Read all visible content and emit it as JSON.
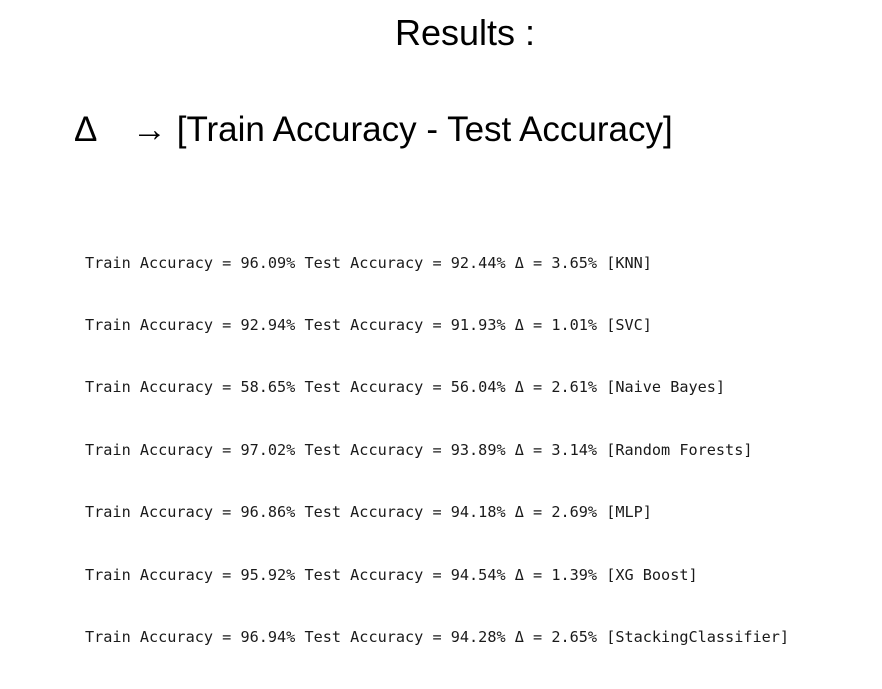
{
  "slide": {
    "title": "Results :",
    "definition": {
      "symbol": "Δ",
      "text": "→ [Train Accuracy - Test Accuracy]"
    },
    "results": [
      "Train Accuracy = 96.09% Test Accuracy = 92.44% Δ = 3.65% [KNN]",
      "Train Accuracy = 92.94% Test Accuracy = 91.93% Δ = 1.01% [SVC]",
      "Train Accuracy = 58.65% Test Accuracy = 56.04% Δ = 2.61% [Naive Bayes]",
      "Train Accuracy = 97.02% Test Accuracy = 93.89% Δ = 3.14% [Random Forests]",
      "Train Accuracy = 96.86% Test Accuracy = 94.18% Δ = 2.69% [MLP]",
      "Train Accuracy = 95.92% Test Accuracy = 94.54% Δ = 1.39% [XG Boost]",
      "Train Accuracy = 96.94% Test Accuracy = 94.28% Δ = 2.65% [StackingClassifier]"
    ]
  }
}
